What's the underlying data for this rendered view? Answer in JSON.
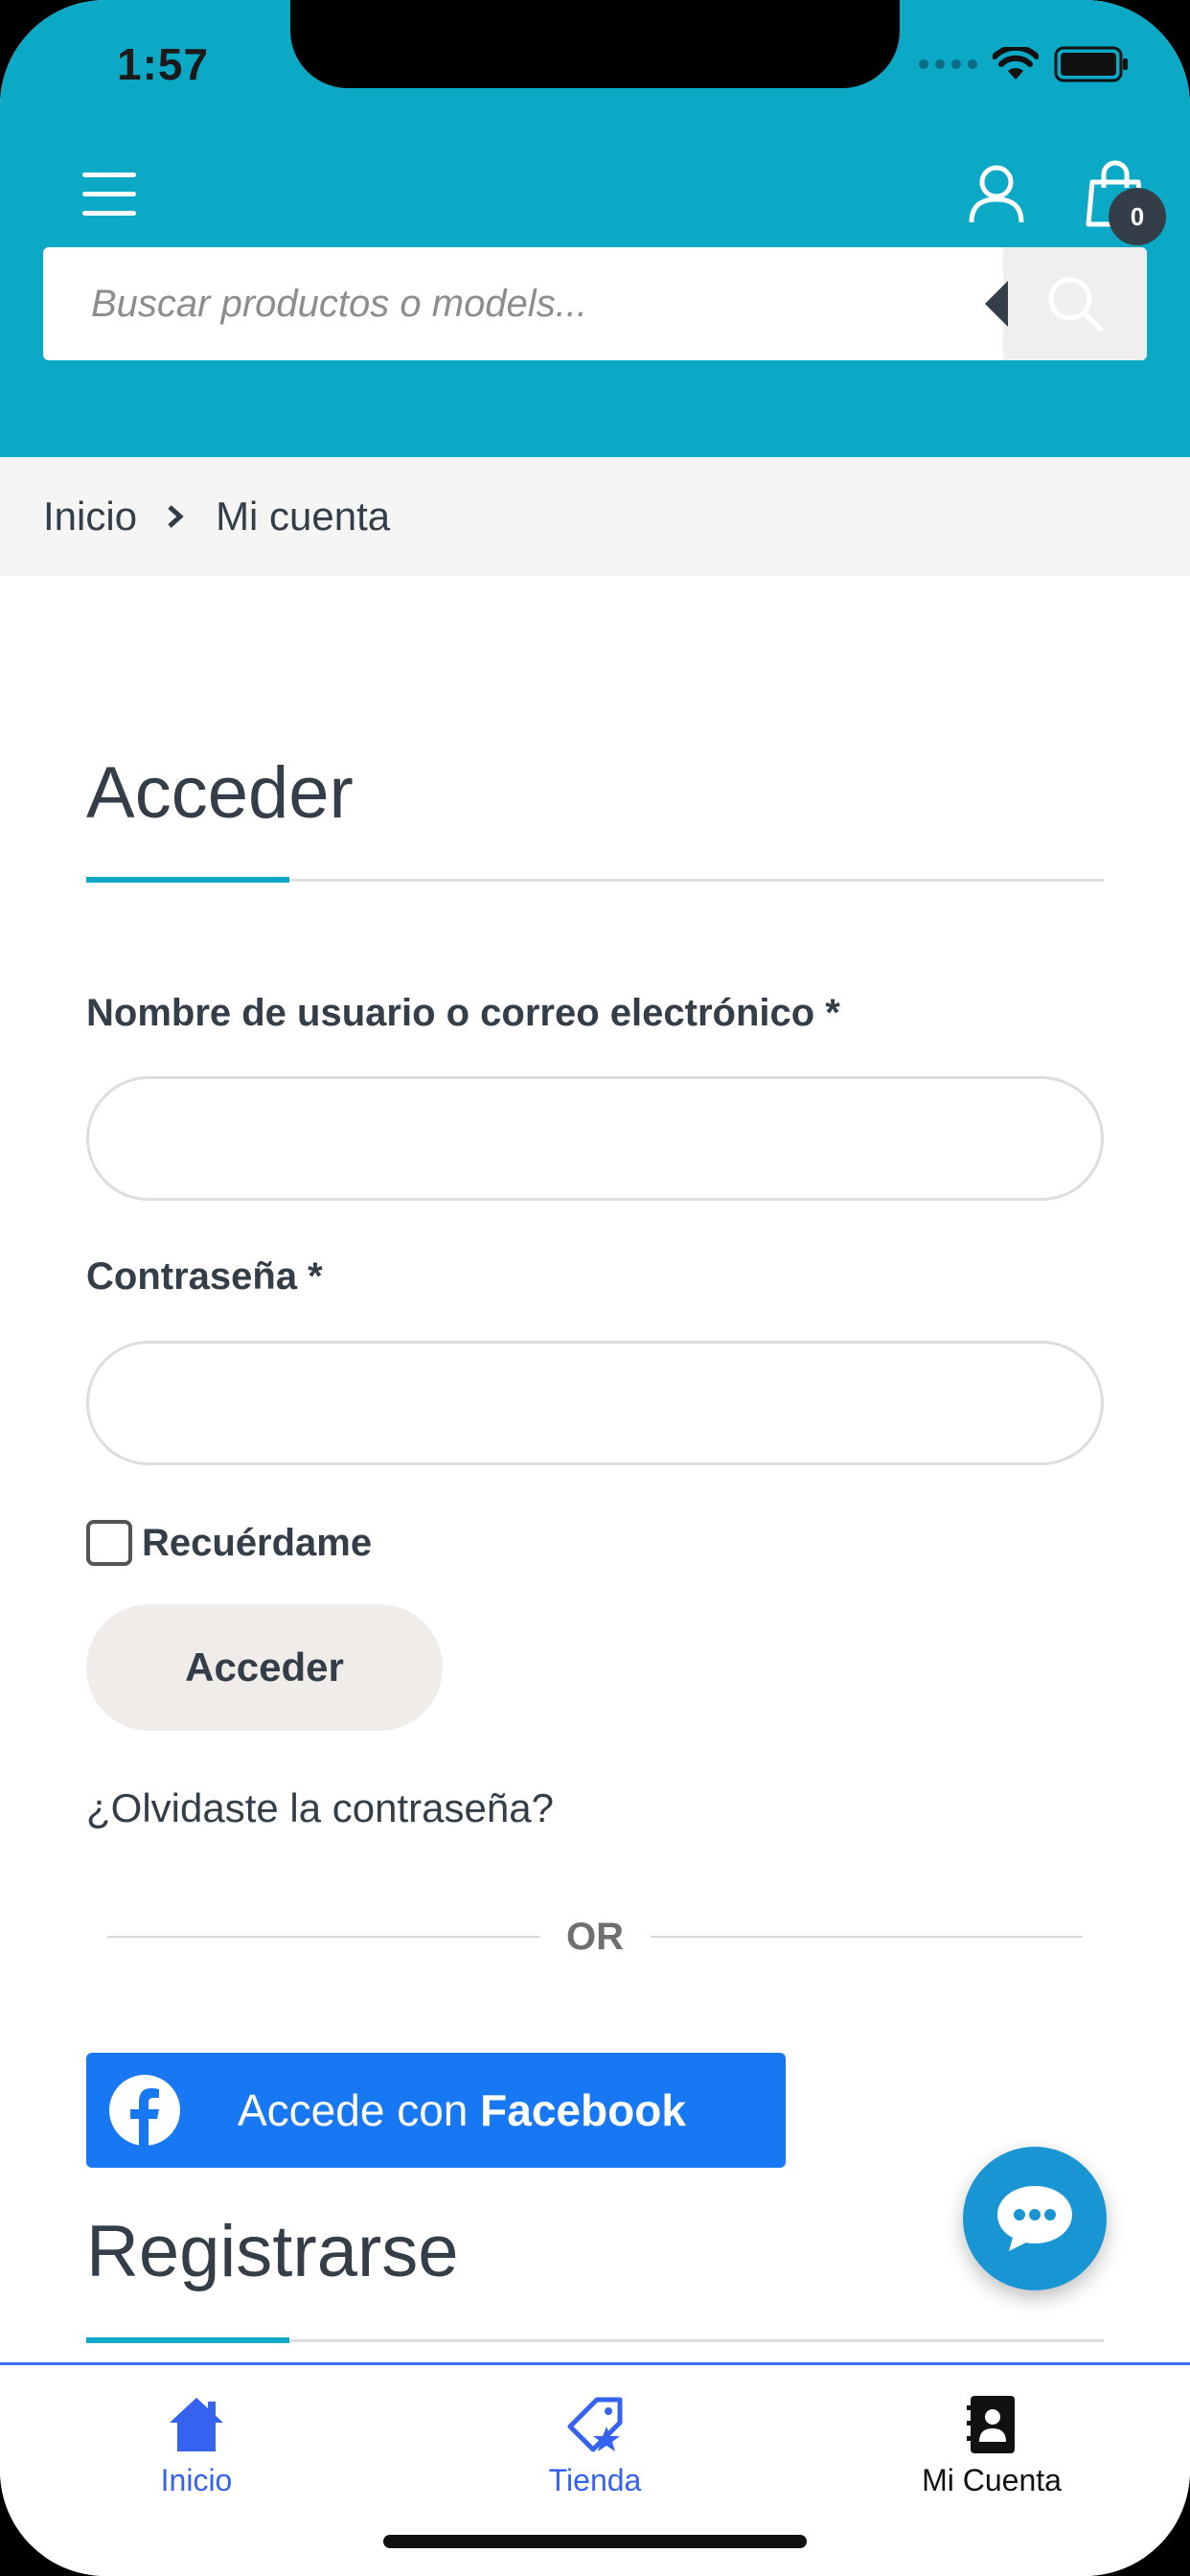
{
  "status_bar": {
    "time": "1:57"
  },
  "header": {
    "cart_count": "0",
    "search": {
      "placeholder": "Buscar productos o models..."
    }
  },
  "breadcrumb": {
    "home": "Inicio",
    "current": "Mi cuenta"
  },
  "login": {
    "title": "Acceder",
    "username_label": "Nombre de usuario o correo electrónico *",
    "password_label": "Contraseña *",
    "remember_label": "Recuérdame",
    "submit_label": "Acceder",
    "forgot_link": "¿Olvidaste la contraseña?",
    "divider_text": "OR",
    "facebook_prefix": "Accede con ",
    "facebook_brand": "Facebook"
  },
  "register": {
    "title": "Registrarse"
  },
  "bottom_nav": {
    "items": [
      {
        "label": "Inicio",
        "icon": "home-icon"
      },
      {
        "label": "Tienda",
        "icon": "tag-star-icon"
      },
      {
        "label": "Mi Cuenta",
        "icon": "contact-book-icon"
      }
    ]
  },
  "colors": {
    "header_bg": "#0ba9c6",
    "accent": "#0ba9c6",
    "facebook": "#1877f2",
    "chat_fab": "#1a95d4",
    "nav_active": "#3563f0"
  }
}
